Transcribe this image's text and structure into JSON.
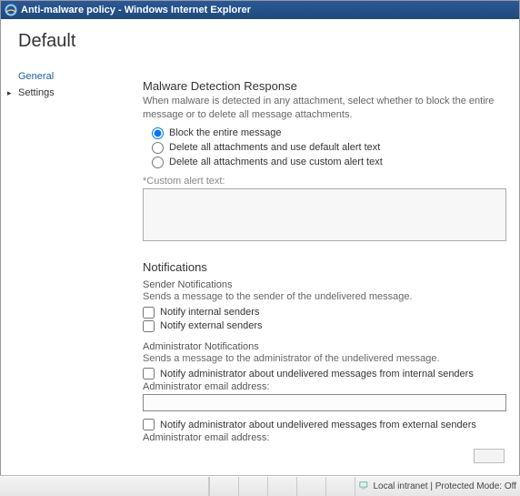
{
  "window": {
    "title": "Anti-malware policy - Windows Internet Explorer"
  },
  "page": {
    "title": "Default"
  },
  "nav": {
    "general": "General",
    "settings": "Settings"
  },
  "malware": {
    "heading": "Malware Detection Response",
    "desc": "When malware is detected in any attachment, select whether to block the entire message or to delete all message attachments.",
    "opt_block": "Block the entire message",
    "opt_delete_default": "Delete all attachments and use default alert text",
    "opt_delete_custom": "Delete all attachments and use custom alert text",
    "custom_label": "*Custom alert text:",
    "custom_value": ""
  },
  "notifications": {
    "heading": "Notifications",
    "sender_sub": "Sender Notifications",
    "sender_desc": "Sends a message to the sender of the undelivered message.",
    "notify_internal_senders": "Notify internal senders",
    "notify_external_senders": "Notify external senders",
    "admin_sub": "Administrator Notifications",
    "admin_desc": "Sends a message to the administrator of the undelivered message.",
    "notify_admin_internal": "Notify administrator about undelivered messages from internal senders",
    "admin_email_label": "Administrator email address:",
    "admin_email_internal_value": "",
    "notify_admin_external": "Notify administrator about undelivered messages from external senders",
    "admin_email_external_value": ""
  },
  "statusbar": {
    "zone": "Local intranet | Protected Mode: Off"
  }
}
